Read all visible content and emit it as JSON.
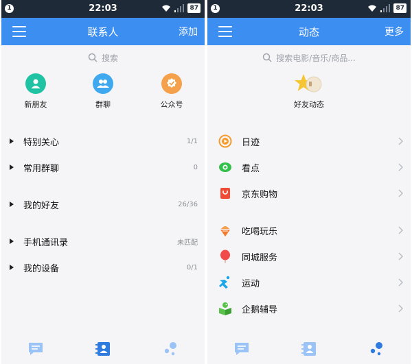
{
  "status": {
    "time": "22:03",
    "notif": "1",
    "battery": "87"
  },
  "contacts": {
    "title": "联系人",
    "add_label": "添加",
    "search_placeholder": "搜索",
    "quick": [
      {
        "label": "新朋友",
        "icon": "person-icon",
        "color": "#1fc3a3"
      },
      {
        "label": "群聊",
        "icon": "group-icon",
        "color": "#3fa8ee"
      },
      {
        "label": "公众号",
        "icon": "badge-check-icon",
        "color": "#f5a04a"
      }
    ],
    "groups": [
      {
        "name": "特别关心",
        "count": "1/1"
      },
      {
        "name": "常用群聊",
        "count": "0"
      },
      {
        "name": "我的好友",
        "count": "26/36"
      },
      {
        "name": "手机通讯录",
        "count": "未匹配"
      },
      {
        "name": "我的设备",
        "count": "0/1"
      }
    ]
  },
  "activity": {
    "title": "动态",
    "more_label": "更多",
    "search_placeholder": "搜索电影/音乐/商品...",
    "friends_feed_label": "好友动态",
    "items": [
      {
        "name": "日迹",
        "icon": "play-circle-icon",
        "color": "#f59a2b"
      },
      {
        "name": "看点",
        "icon": "eye-icon",
        "color": "#33c04a"
      },
      {
        "name": "京东购物",
        "icon": "shopping-bag-icon",
        "color": "#ee4a35"
      },
      {
        "name": "吃喝玩乐",
        "icon": "ice-cream-icon",
        "color": "#f5a04a"
      },
      {
        "name": "同城服务",
        "icon": "balloon-icon",
        "color": "#f04a4a"
      },
      {
        "name": "运动",
        "icon": "running-icon",
        "color": "#1aa6e8"
      },
      {
        "name": "企鹅辅导",
        "icon": "penguin-book-icon",
        "color": "#5ac24a"
      }
    ]
  },
  "colors": {
    "accent": "#3d8ef1",
    "statusbar": "#1f2a38",
    "tab_active": "#2f7be0",
    "tab_inactive": "#9cc3f5"
  }
}
